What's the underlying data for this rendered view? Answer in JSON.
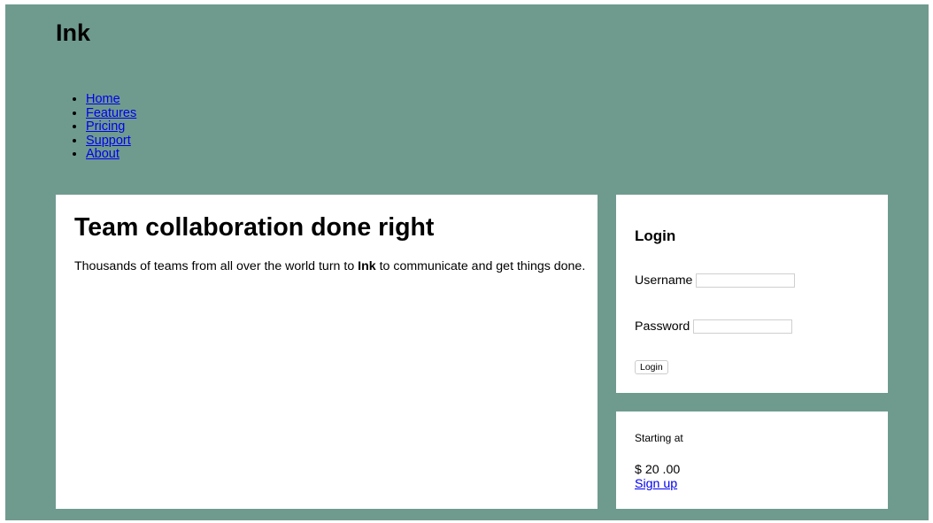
{
  "header": {
    "logo": "Ink"
  },
  "nav": {
    "items": [
      {
        "label": "Home"
      },
      {
        "label": "Features"
      },
      {
        "label": "Pricing"
      },
      {
        "label": "Support"
      },
      {
        "label": "About"
      }
    ]
  },
  "hero": {
    "title": "Team collaboration done right",
    "text_before": "Thousands of teams from all over the world turn to ",
    "text_bold": "Ink",
    "text_after": " to communicate and get things done."
  },
  "login": {
    "title": "Login",
    "username_label": "Username",
    "username_value": "",
    "password_label": "Password",
    "password_value": "",
    "button_label": "Login"
  },
  "pricing": {
    "starting_label": "Starting at",
    "price": "$ 20 .00",
    "signup_label": "Sign up"
  },
  "colors": {
    "background": "#6f9b8f",
    "panel": "#ffffff",
    "link": "#0000ee"
  }
}
